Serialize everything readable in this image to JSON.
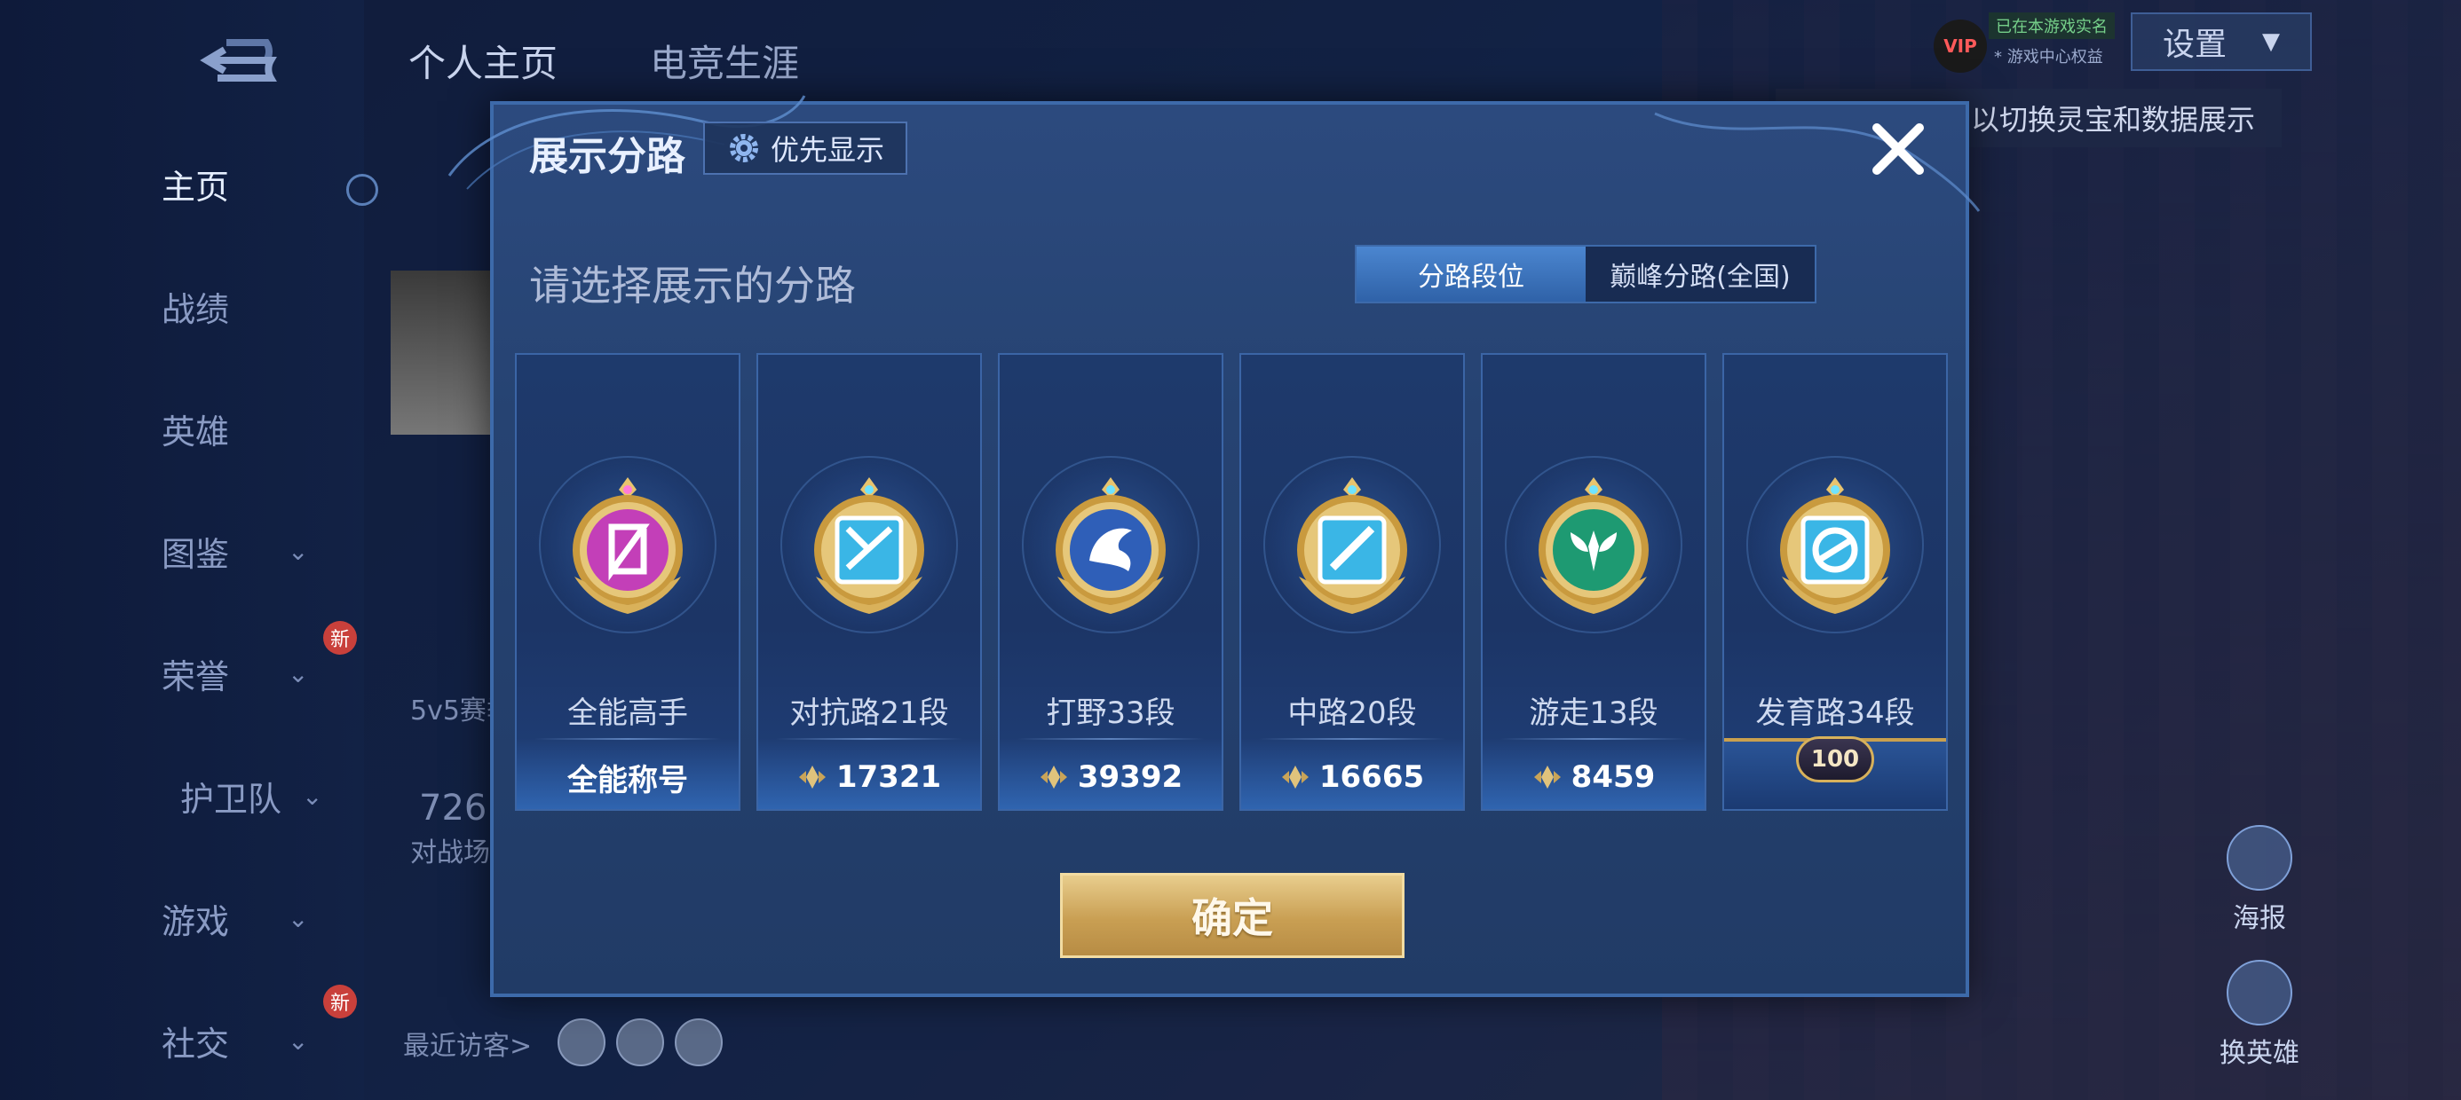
{
  "leftnav": {
    "items": [
      {
        "label": "主页",
        "active": true
      },
      {
        "label": "战绩"
      },
      {
        "label": "英雄"
      },
      {
        "label": "图鉴"
      },
      {
        "label": "荣誉",
        "badge": "新"
      },
      {
        "label": "护卫队"
      },
      {
        "label": "游戏"
      },
      {
        "label": "社交",
        "badge": "新"
      }
    ]
  },
  "top_tabs": [
    "个人主页",
    "电竞生涯"
  ],
  "top_right": {
    "vip": "VIP",
    "line1": "已在本游戏实名",
    "line2": "* 游戏中心权益",
    "settings": "设置",
    "hint": "以切换灵宝和数据展示"
  },
  "side_buttons": [
    "海报",
    "换英雄"
  ],
  "background": {
    "mode_text": "5v5赛季",
    "score_text": "726",
    "battle_text": "对战场",
    "visitors": "最近访客>"
  },
  "modal": {
    "title": "展示分路",
    "priority_label": "优先显示",
    "subtitle": "请选择展示的分路",
    "toggle": [
      {
        "label": "分路段位",
        "active": true
      },
      {
        "label": "巅峰分路(全国)",
        "active": false
      }
    ],
    "cards": [
      {
        "name": "全能高手",
        "stat": "全能称号",
        "icon": "all-round-emblem",
        "color": "#c33fb8"
      },
      {
        "name": "对抗路21段",
        "stat": "17321",
        "icon": "clash-lane-emblem",
        "color": "#3ab6e6"
      },
      {
        "name": "打野33段",
        "stat": "39392",
        "icon": "jungle-emblem",
        "color": "#2f5fb8"
      },
      {
        "name": "中路20段",
        "stat": "16665",
        "icon": "mid-lane-emblem",
        "color": "#3ab6e6"
      },
      {
        "name": "游走13段",
        "stat": "8459",
        "icon": "roam-emblem",
        "color": "#1e9a72"
      },
      {
        "name": "发育路34段",
        "stat": "100",
        "icon": "farm-lane-emblem",
        "color": "#3ab6e6"
      }
    ],
    "confirm": "确定"
  }
}
